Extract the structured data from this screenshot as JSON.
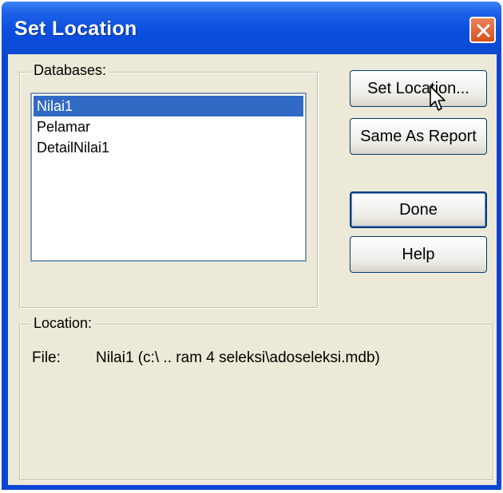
{
  "window": {
    "title": "Set Location"
  },
  "databases": {
    "group_label": "Databases:",
    "items": [
      {
        "label": "Nilai1",
        "selected": true
      },
      {
        "label": "Pelamar",
        "selected": false
      },
      {
        "label": "DetailNilai1",
        "selected": false
      }
    ]
  },
  "buttons": {
    "set_location": "Set Location...",
    "same_as_report": "Same As Report",
    "done": "Done",
    "help": "Help"
  },
  "location": {
    "group_label": "Location:",
    "file_label": "File:",
    "file_value": "Nilai1 (c:\\ .. ram 4 seleksi\\adoseleksi.mdb)"
  },
  "colors": {
    "titlebar": "#0a4fe0",
    "selection": "#316ac5",
    "dialog_bg": "#ece9d8",
    "close_button": "#d8501e"
  }
}
